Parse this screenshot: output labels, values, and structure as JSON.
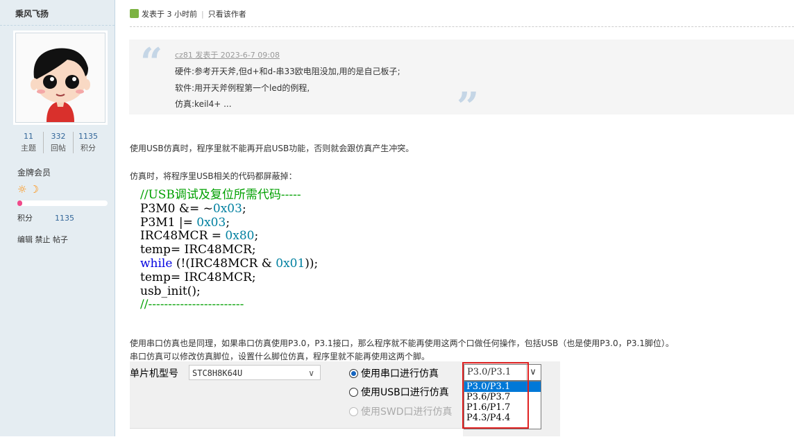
{
  "user": {
    "name": "乘风飞扬",
    "stats": [
      {
        "value": "11",
        "label": "主题"
      },
      {
        "value": "332",
        "label": "回帖"
      },
      {
        "value": "1135",
        "label": "积分"
      }
    ],
    "rank": "金牌会员",
    "rank_icons": "☼☽",
    "progress_fraction": 0.03,
    "points_label": "积分",
    "points_value": "1135",
    "mod_links": "编辑 禁止 帖子"
  },
  "post": {
    "posted": "发表于 3 小时前",
    "sep": "|",
    "only_author": "只看该作者",
    "quote": {
      "author_line": "cz81 发表于 2023-6-7 09:08",
      "lines": [
        "硬件:参考开天斧,但d+和d-串33欧电阻没加,用的是自己板子;",
        "软件:用开天斧例程第一个led的例程,",
        "仿真:keil4+ ..."
      ]
    },
    "para1": "使用USB仿真时，程序里就不能再开启USB功能，否则就会跟仿真产生冲突。",
    "para2": "仿真时，将程序里USB相关的代码都屏蔽掉：",
    "code": {
      "l1": "//USB调试及复位所需代码-----",
      "l2a": "P3M0 &= ~",
      "l2b": "0x03",
      "l2c": ";",
      "l3a": "P3M1 |= ",
      "l3b": "0x03",
      "l3c": ";",
      "l4a": "IRC48MCR = ",
      "l4b": "0x80",
      "l4c": ";",
      "l5": "temp= IRC48MCR;",
      "l6a": "while",
      "l6b": " (!(IRC48MCR & ",
      "l6c": "0x01",
      "l6d": "));",
      "l7": "temp= IRC48MCR;",
      "l8": "usb_init();",
      "l9": "//------------------------"
    },
    "para3": "使用串口仿真也是同理，如果串口仿真使用P3.0，P3.1接口，那么程序就不能再使用这两个口做任何操作，包括USB（也是使用P3.0，P3.1脚位）。",
    "para4": "串口仿真可以修改仿真脚位，设置什么脚位仿真，程序里就不能再使用这两个脚。"
  },
  "settings": {
    "mcu_label": "单片机型号",
    "mcu_value": "STC8H8K64U",
    "radio_serial": "使用串口进行仿真",
    "radio_usb": "使用USB口进行仿真",
    "radio_swd": "使用SWD口进行仿真",
    "port_value": "P3.0/P3.1",
    "port_options": [
      "P3.0/P3.1",
      "P3.6/P3.7",
      "P1.6/P1.7",
      "P4.3/P4.4"
    ],
    "highlight_color": "#e02020"
  }
}
